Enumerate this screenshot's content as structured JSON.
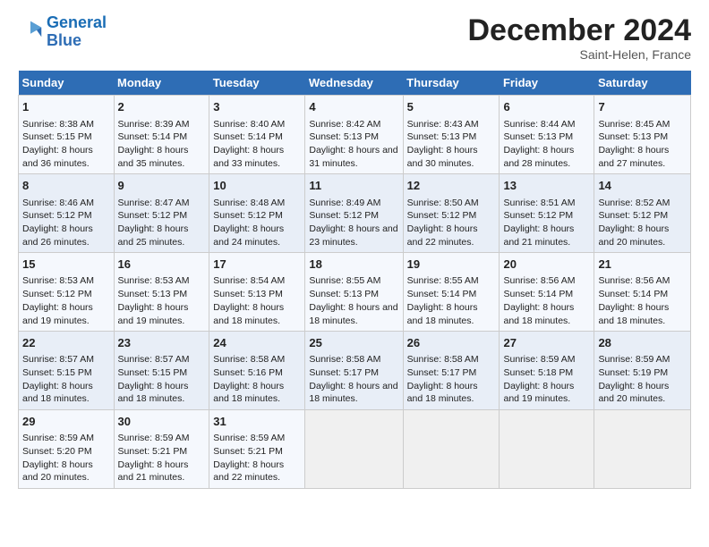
{
  "logo": {
    "line1": "General",
    "line2": "Blue"
  },
  "title": "December 2024",
  "subtitle": "Saint-Helen, France",
  "days_header": [
    "Sunday",
    "Monday",
    "Tuesday",
    "Wednesday",
    "Thursday",
    "Friday",
    "Saturday"
  ],
  "weeks": [
    [
      {
        "day": "1",
        "sunrise": "Sunrise: 8:38 AM",
        "sunset": "Sunset: 5:15 PM",
        "daylight": "Daylight: 8 hours and 36 minutes."
      },
      {
        "day": "2",
        "sunrise": "Sunrise: 8:39 AM",
        "sunset": "Sunset: 5:14 PM",
        "daylight": "Daylight: 8 hours and 35 minutes."
      },
      {
        "day": "3",
        "sunrise": "Sunrise: 8:40 AM",
        "sunset": "Sunset: 5:14 PM",
        "daylight": "Daylight: 8 hours and 33 minutes."
      },
      {
        "day": "4",
        "sunrise": "Sunrise: 8:42 AM",
        "sunset": "Sunset: 5:13 PM",
        "daylight": "Daylight: 8 hours and 31 minutes."
      },
      {
        "day": "5",
        "sunrise": "Sunrise: 8:43 AM",
        "sunset": "Sunset: 5:13 PM",
        "daylight": "Daylight: 8 hours and 30 minutes."
      },
      {
        "day": "6",
        "sunrise": "Sunrise: 8:44 AM",
        "sunset": "Sunset: 5:13 PM",
        "daylight": "Daylight: 8 hours and 28 minutes."
      },
      {
        "day": "7",
        "sunrise": "Sunrise: 8:45 AM",
        "sunset": "Sunset: 5:13 PM",
        "daylight": "Daylight: 8 hours and 27 minutes."
      }
    ],
    [
      {
        "day": "8",
        "sunrise": "Sunrise: 8:46 AM",
        "sunset": "Sunset: 5:12 PM",
        "daylight": "Daylight: 8 hours and 26 minutes."
      },
      {
        "day": "9",
        "sunrise": "Sunrise: 8:47 AM",
        "sunset": "Sunset: 5:12 PM",
        "daylight": "Daylight: 8 hours and 25 minutes."
      },
      {
        "day": "10",
        "sunrise": "Sunrise: 8:48 AM",
        "sunset": "Sunset: 5:12 PM",
        "daylight": "Daylight: 8 hours and 24 minutes."
      },
      {
        "day": "11",
        "sunrise": "Sunrise: 8:49 AM",
        "sunset": "Sunset: 5:12 PM",
        "daylight": "Daylight: 8 hours and 23 minutes."
      },
      {
        "day": "12",
        "sunrise": "Sunrise: 8:50 AM",
        "sunset": "Sunset: 5:12 PM",
        "daylight": "Daylight: 8 hours and 22 minutes."
      },
      {
        "day": "13",
        "sunrise": "Sunrise: 8:51 AM",
        "sunset": "Sunset: 5:12 PM",
        "daylight": "Daylight: 8 hours and 21 minutes."
      },
      {
        "day": "14",
        "sunrise": "Sunrise: 8:52 AM",
        "sunset": "Sunset: 5:12 PM",
        "daylight": "Daylight: 8 hours and 20 minutes."
      }
    ],
    [
      {
        "day": "15",
        "sunrise": "Sunrise: 8:53 AM",
        "sunset": "Sunset: 5:12 PM",
        "daylight": "Daylight: 8 hours and 19 minutes."
      },
      {
        "day": "16",
        "sunrise": "Sunrise: 8:53 AM",
        "sunset": "Sunset: 5:13 PM",
        "daylight": "Daylight: 8 hours and 19 minutes."
      },
      {
        "day": "17",
        "sunrise": "Sunrise: 8:54 AM",
        "sunset": "Sunset: 5:13 PM",
        "daylight": "Daylight: 8 hours and 18 minutes."
      },
      {
        "day": "18",
        "sunrise": "Sunrise: 8:55 AM",
        "sunset": "Sunset: 5:13 PM",
        "daylight": "Daylight: 8 hours and 18 minutes."
      },
      {
        "day": "19",
        "sunrise": "Sunrise: 8:55 AM",
        "sunset": "Sunset: 5:14 PM",
        "daylight": "Daylight: 8 hours and 18 minutes."
      },
      {
        "day": "20",
        "sunrise": "Sunrise: 8:56 AM",
        "sunset": "Sunset: 5:14 PM",
        "daylight": "Daylight: 8 hours and 18 minutes."
      },
      {
        "day": "21",
        "sunrise": "Sunrise: 8:56 AM",
        "sunset": "Sunset: 5:14 PM",
        "daylight": "Daylight: 8 hours and 18 minutes."
      }
    ],
    [
      {
        "day": "22",
        "sunrise": "Sunrise: 8:57 AM",
        "sunset": "Sunset: 5:15 PM",
        "daylight": "Daylight: 8 hours and 18 minutes."
      },
      {
        "day": "23",
        "sunrise": "Sunrise: 8:57 AM",
        "sunset": "Sunset: 5:15 PM",
        "daylight": "Daylight: 8 hours and 18 minutes."
      },
      {
        "day": "24",
        "sunrise": "Sunrise: 8:58 AM",
        "sunset": "Sunset: 5:16 PM",
        "daylight": "Daylight: 8 hours and 18 minutes."
      },
      {
        "day": "25",
        "sunrise": "Sunrise: 8:58 AM",
        "sunset": "Sunset: 5:17 PM",
        "daylight": "Daylight: 8 hours and 18 minutes."
      },
      {
        "day": "26",
        "sunrise": "Sunrise: 8:58 AM",
        "sunset": "Sunset: 5:17 PM",
        "daylight": "Daylight: 8 hours and 18 minutes."
      },
      {
        "day": "27",
        "sunrise": "Sunrise: 8:59 AM",
        "sunset": "Sunset: 5:18 PM",
        "daylight": "Daylight: 8 hours and 19 minutes."
      },
      {
        "day": "28",
        "sunrise": "Sunrise: 8:59 AM",
        "sunset": "Sunset: 5:19 PM",
        "daylight": "Daylight: 8 hours and 20 minutes."
      }
    ],
    [
      {
        "day": "29",
        "sunrise": "Sunrise: 8:59 AM",
        "sunset": "Sunset: 5:20 PM",
        "daylight": "Daylight: 8 hours and 20 minutes."
      },
      {
        "day": "30",
        "sunrise": "Sunrise: 8:59 AM",
        "sunset": "Sunset: 5:21 PM",
        "daylight": "Daylight: 8 hours and 21 minutes."
      },
      {
        "day": "31",
        "sunrise": "Sunrise: 8:59 AM",
        "sunset": "Sunset: 5:21 PM",
        "daylight": "Daylight: 8 hours and 22 minutes."
      },
      null,
      null,
      null,
      null
    ]
  ]
}
